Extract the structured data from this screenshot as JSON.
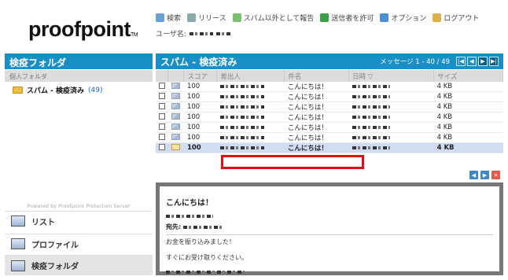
{
  "brand": {
    "logo": "proofpoint",
    "tm": "TM"
  },
  "toolbar": [
    {
      "icon": "search-icon",
      "label": "検索",
      "color": "#6aa0d8"
    },
    {
      "icon": "release-icon",
      "label": "リリース",
      "color": "#8aa"
    },
    {
      "icon": "report-icon",
      "label": "スパム以外として報告",
      "color": "#7ac070"
    },
    {
      "icon": "allow-sender-icon",
      "label": "送信者を許可",
      "color": "#3aa045"
    },
    {
      "icon": "options-icon",
      "label": "オプション",
      "color": "#4a8fd4"
    },
    {
      "icon": "logout-icon",
      "label": "ログアウト",
      "color": "#e0b040"
    }
  ],
  "user": {
    "label": "ユーザ名:"
  },
  "left": {
    "title": "検疫フォルダ",
    "subtitle": "個人フォルダ",
    "folder_name": "スパム - 検疫済み",
    "folder_count": "(49)",
    "powered": "Powered by Proofpoint Protection Server"
  },
  "nav": [
    {
      "label": "リスト",
      "icon": "list-icon"
    },
    {
      "label": "プロファイル",
      "icon": "profile-icon"
    },
    {
      "label": "検疫フォルダ",
      "icon": "quarantine-icon"
    }
  ],
  "main": {
    "title": "スパム - 検疫済み",
    "count": "メッセージ 1 - 40 / 49"
  },
  "columns": [
    "",
    "",
    "スコア",
    "差出人",
    "件名",
    "日時 ▽",
    "サイズ"
  ],
  "rows": [
    {
      "score": "100",
      "subject": "こんにちは！",
      "size": "4 KB",
      "selected": false
    },
    {
      "score": "100",
      "subject": "こんにちは！",
      "size": "4 KB",
      "selected": false
    },
    {
      "score": "100",
      "subject": "こんにちは！",
      "size": "4 KB",
      "selected": false
    },
    {
      "score": "100",
      "subject": "こんにちは！",
      "size": "4 KB",
      "selected": false
    },
    {
      "score": "100",
      "subject": "こんにちは！",
      "size": "4 KB",
      "selected": false
    },
    {
      "score": "100",
      "subject": "こんにちは！",
      "size": "4 KB",
      "selected": false
    },
    {
      "score": "100",
      "subject": "こんにちは！",
      "size": "4 KB",
      "selected": true
    }
  ],
  "preview": {
    "subject": "こんにちは！",
    "to_label": "宛先:",
    "line1": "お金を振り込みました！",
    "line2": "すぐにお受け取りください。"
  }
}
